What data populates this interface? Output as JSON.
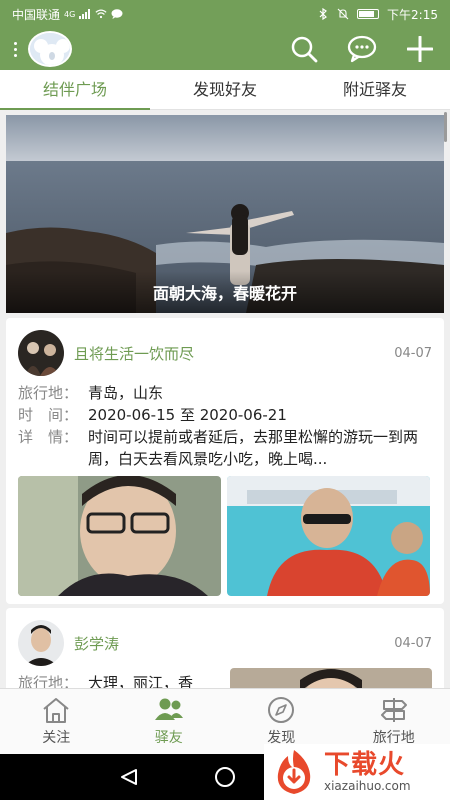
{
  "status_bar": {
    "carrier": "中国联通",
    "network": "4G",
    "time": "下午2:15"
  },
  "colors": {
    "brand": "#739f59",
    "accent": "#6e9b52",
    "watermark": "#e8492c"
  },
  "appbar": {
    "icons": [
      "menu-icon",
      "avatar",
      "search-icon",
      "message-icon",
      "add-icon"
    ]
  },
  "tabs": [
    {
      "label": "结伴广场",
      "active": true
    },
    {
      "label": "发现好友",
      "active": false
    },
    {
      "label": "附近驿友",
      "active": false
    }
  ],
  "banner": {
    "caption": "面朝大海，春暖花开"
  },
  "posts": [
    {
      "user": "且将生活一饮而尽",
      "date": "04-07",
      "dest_label": "旅行地：",
      "dest": "青岛，山东",
      "time_label": "时　间：",
      "time": "2020-06-15 至 2020-06-21",
      "detail_label": "详　情：",
      "detail": "时间可以提前或者延后，去那里松懈的游玩一到两周，白天去看风景吃小吃，晚上喝..."
    },
    {
      "user": "彭学涛",
      "date": "04-07",
      "dest_label": "旅行地：",
      "dest": "大理，丽江，香"
    }
  ],
  "bottom_nav": [
    {
      "label": "关注",
      "icon": "home-icon",
      "active": false
    },
    {
      "label": "驿友",
      "icon": "friends-icon",
      "active": true
    },
    {
      "label": "发现",
      "icon": "compass-icon",
      "active": false
    },
    {
      "label": "旅行地",
      "icon": "signpost-icon",
      "active": false
    }
  ],
  "watermark": {
    "title": "下载火",
    "url": "xiazaihuo.com"
  }
}
